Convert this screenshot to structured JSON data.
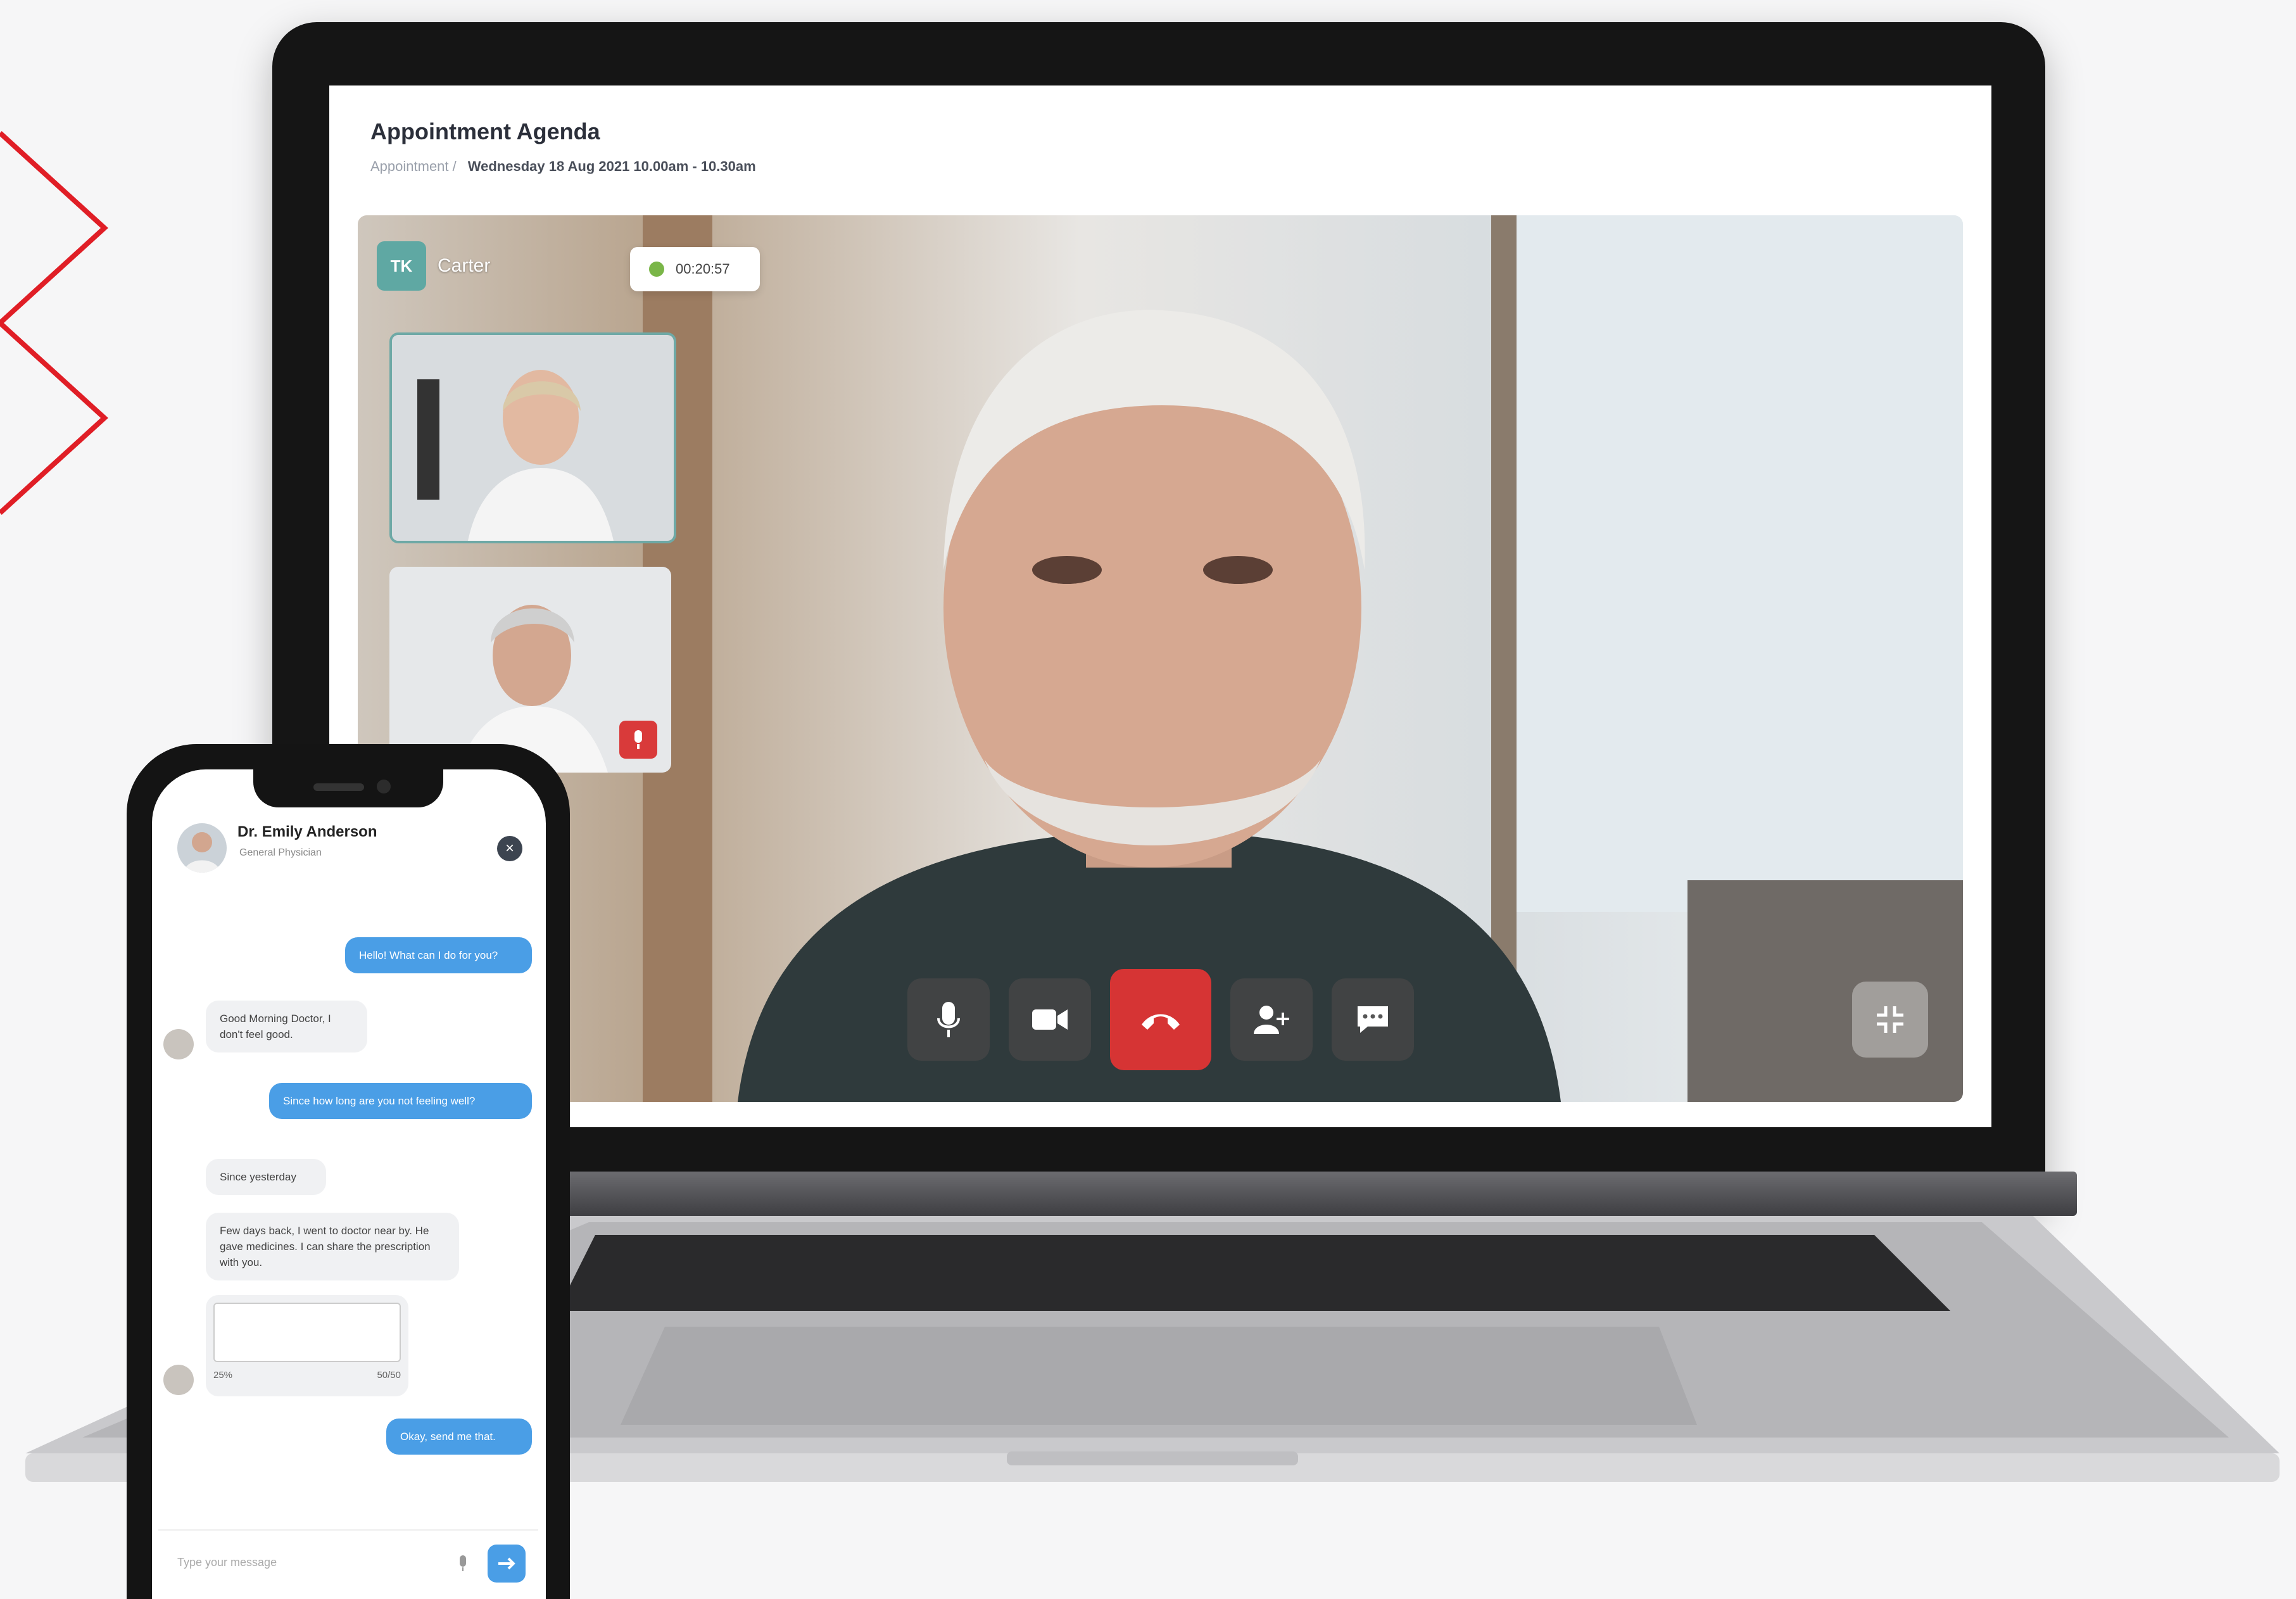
{
  "colors": {
    "accent_red": "#d63434",
    "chat_blue": "#4a9ee6",
    "teal_avatar": "#5fa8a3",
    "status_green": "#7ab648",
    "deco_red": "#e01e26"
  },
  "laptop": {
    "page_title": "Appointment Agenda",
    "breadcrumb_root": "Appointment /",
    "breadcrumb_detail": "Wednesday 18 Aug 2021  10.00am - 10.30am",
    "call": {
      "participant_initials": "TK",
      "participant_name": "Carter",
      "timer": "00:20:57",
      "controls": [
        "mic-icon",
        "video-camera-icon",
        "end-call-icon",
        "add-person-icon",
        "chat-icon"
      ],
      "expand_icon": "collapse-fullscreen-icon"
    }
  },
  "phone": {
    "doctor_name": "Dr. Emily Anderson",
    "doctor_role": "General Physician",
    "messages": [
      {
        "from": "me",
        "text": "Hello! What can I do for you?"
      },
      {
        "from": "doctor",
        "text": "Good Morning Doctor, I don't feel good."
      },
      {
        "from": "me",
        "text": "Since how long are you not feeling well?"
      },
      {
        "from": "doctor",
        "text": "Since yesterday"
      },
      {
        "from": "doctor",
        "text": "Few days back, I went to doctor near by. He gave medicines. I can share the prescription with you."
      },
      {
        "from": "me",
        "text": "Okay, send me that."
      }
    ],
    "attachment_left": "25%",
    "attachment_right": "50/50",
    "input_placeholder": "Type your message"
  }
}
